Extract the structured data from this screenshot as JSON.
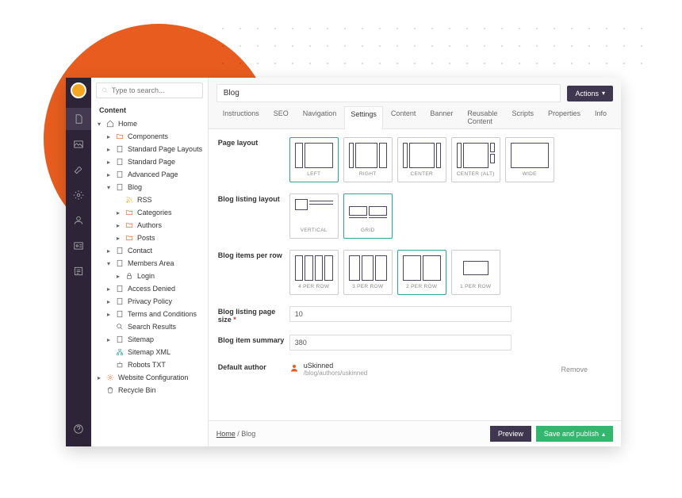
{
  "search": {
    "placeholder": "Type to search..."
  },
  "section_label": "Content",
  "tree": {
    "home": "Home",
    "components": "Components",
    "standard_page_layouts": "Standard Page Layouts",
    "standard_page": "Standard Page",
    "advanced_page": "Advanced Page",
    "blog": "Blog",
    "rss": "RSS",
    "categories": "Categories",
    "authors": "Authors",
    "posts": "Posts",
    "contact": "Contact",
    "members_area": "Members Area",
    "login": "Login",
    "access_denied": "Access Denied",
    "privacy_policy": "Privacy Policy",
    "terms": "Terms and Conditions",
    "search_results": "Search Results",
    "sitemap": "Sitemap",
    "sitemap_xml": "Sitemap XML",
    "robots": "Robots TXT",
    "website_config": "Website Configuration",
    "recycle": "Recycle Bin"
  },
  "page_title": "Blog",
  "actions_label": "Actions",
  "tabs": [
    "Instructions",
    "SEO",
    "Navigation",
    "Settings",
    "Content",
    "Banner",
    "Reusable Content",
    "Scripts",
    "Properties",
    "Info"
  ],
  "active_tab": "Settings",
  "fields": {
    "page_layout": {
      "label": "Page layout",
      "options": [
        "LEFT",
        "RIGHT",
        "CENTER",
        "CENTER (ALT)",
        "WIDE"
      ],
      "selected": "LEFT"
    },
    "blog_listing_layout": {
      "label": "Blog listing layout",
      "options": [
        "VERTICAL",
        "GRID"
      ],
      "selected": "GRID"
    },
    "items_per_row": {
      "label": "Blog items per row",
      "options": [
        "4 PER ROW",
        "3 PER ROW",
        "2 PER ROW",
        "1 PER ROW"
      ],
      "selected": "2 PER ROW"
    },
    "page_size": {
      "label": "Blog listing page size",
      "value": "10",
      "required": true
    },
    "summary": {
      "label": "Blog item summary",
      "value": "380"
    },
    "default_author": {
      "label": "Default author",
      "name": "uSkinned",
      "path": "/blog/authors/uskinned",
      "remove": "Remove"
    }
  },
  "breadcrumb": {
    "home": "Home",
    "current": "Blog"
  },
  "buttons": {
    "preview": "Preview",
    "save": "Save and publish"
  }
}
